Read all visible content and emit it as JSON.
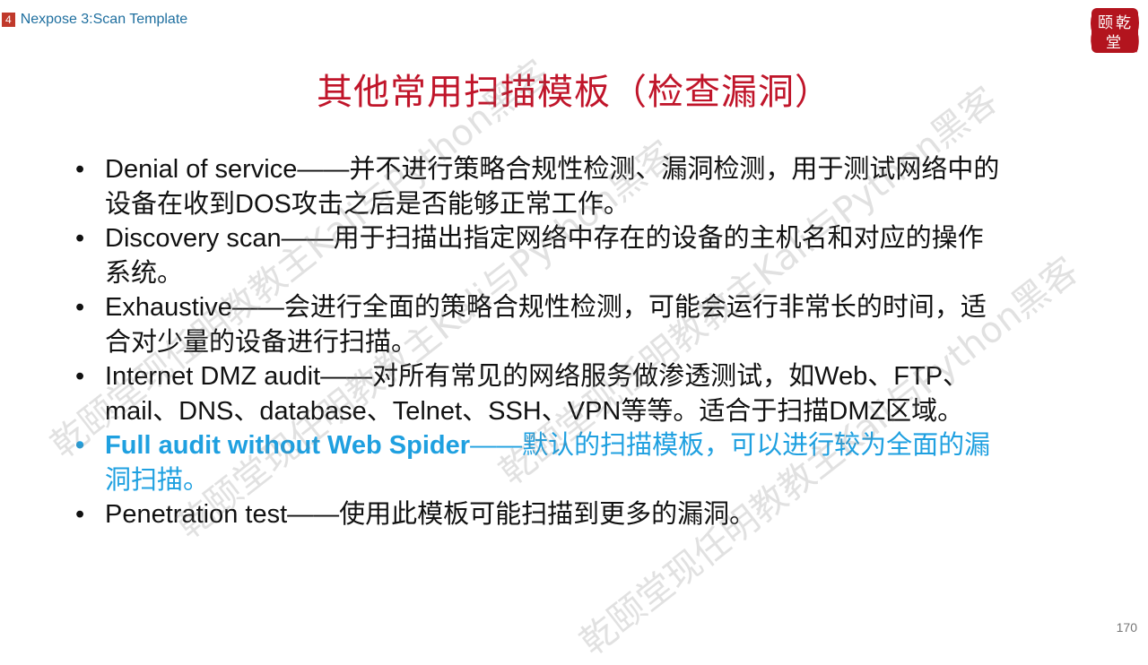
{
  "header": {
    "section_number": "4",
    "section_title": "Nexpose 3:Scan Template"
  },
  "logo": {
    "text": "乾颐堂"
  },
  "title": "其他常用扫描模板（检查漏洞）",
  "items": [
    {
      "term": "Denial of service",
      "desc": "——并不进行策略合规性检测、漏洞检测，用于测试网络中的设备在收到DOS攻击之后是否能够正常工作。"
    },
    {
      "term": "Discovery scan",
      "desc": "——用于扫描出指定网络中存在的设备的主机名和对应的操作系统。"
    },
    {
      "term": "Exhaustive",
      "desc": "——会进行全面的策略合规性检测，可能会运行非常长的时间，适合对少量的设备进行扫描。"
    },
    {
      "term": "Internet DMZ audit",
      "desc": "——对所有常见的网络服务做渗透测试，如Web、FTP、mail、DNS、database、Telnet、SSH、VPN等等。适合于扫描DMZ区域。"
    },
    {
      "term": "Full audit without Web Spider",
      "desc": "——默认的扫描模板，可以进行较为全面的漏洞扫描。"
    },
    {
      "term": "Penetration test",
      "desc": "——使用此模板可能扫描到更多的漏洞。"
    }
  ],
  "watermark": {
    "text_1": "乾颐堂现任明教教主Kali与Python黑客",
    "text_2": "乾颐堂现任明教教主Kali与Python黑客",
    "text_3": "乾颐堂现任明教教主Kali与Python黑客",
    "text_4": "乾颐堂现任明教教主Kali与Python黑客"
  },
  "page_number": "170",
  "colors": {
    "title": "#c0152a",
    "highlight": "#1fa0e0",
    "section_badge": "#c0392b",
    "header_text": "#1f6f9f"
  }
}
